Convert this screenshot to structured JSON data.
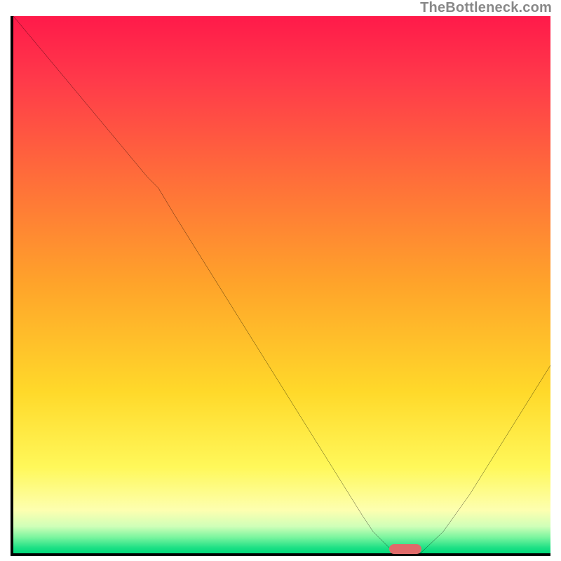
{
  "watermark": "TheBottleneck.com",
  "chart_data": {
    "type": "line",
    "title": "",
    "xlabel": "",
    "ylabel": "",
    "xlim": [
      0,
      100
    ],
    "ylim": [
      0,
      100
    ],
    "series": [
      {
        "name": "curve",
        "x": [
          0,
          5,
          10,
          15,
          20,
          25,
          27,
          30,
          35,
          40,
          45,
          50,
          55,
          60,
          65,
          67,
          70,
          74,
          76,
          80,
          85,
          90,
          95,
          100
        ],
        "y": [
          100,
          94,
          88,
          82,
          76,
          70,
          68,
          63,
          55,
          47,
          39,
          31,
          23,
          15,
          7,
          4,
          1,
          0.2,
          0.2,
          4,
          11,
          19,
          27,
          35
        ]
      }
    ],
    "marker": {
      "x_pct": 73,
      "y_pct": 0.3,
      "color": "#e06a6a"
    },
    "gradient_stops": [
      {
        "pos": 0,
        "color": "#ff1a4a"
      },
      {
        "pos": 50,
        "color": "#ffa42a"
      },
      {
        "pos": 85,
        "color": "#fff85a"
      },
      {
        "pos": 100,
        "color": "#00d879"
      }
    ]
  }
}
